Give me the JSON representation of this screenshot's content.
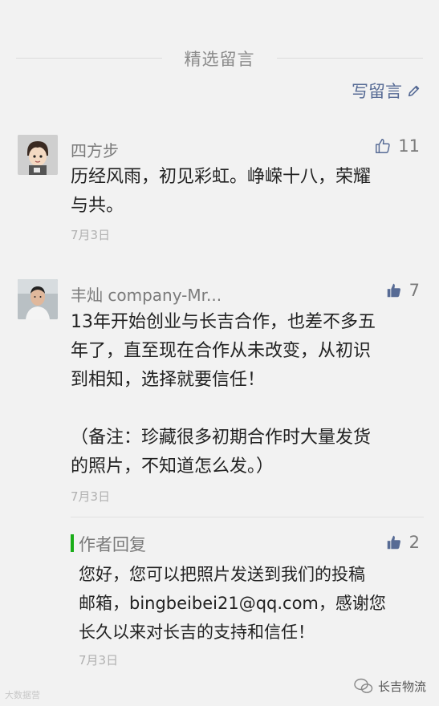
{
  "section": {
    "title": "精选留言"
  },
  "write_button": {
    "label": "写留言",
    "icon": "pencil-icon"
  },
  "comments": [
    {
      "name": "四方步",
      "likes": "11",
      "content": "历经风雨，初见彩虹。峥嵘十八，荣耀\n与共。",
      "date": "7月3日",
      "avatar": "cartoon-avatar",
      "like_filled": false
    },
    {
      "name": "丰灿 company-Mr...",
      "likes": "7",
      "content": "13年开始创业与长吉合作，也差不多五\n年了，直至现在合作从未改变，从初识\n到相知，选择就要信任！\n\n（备注：珍藏很多初期合作时大量发货\n的照片，不知道怎么发。）",
      "date": "7月3日",
      "avatar": "photo-avatar",
      "like_filled": true,
      "reply": {
        "title": "作者回复",
        "likes": "2",
        "content": "您好，您可以把照片发送到我们的投稿\n邮箱，bingbeibei21@qq.com，感谢您\n长久以来对长吉的支持和信任！",
        "date": "7月3日"
      }
    }
  ],
  "watermarks": {
    "left": "大数据营",
    "right": "长吉物流"
  },
  "colors": {
    "link": "#576b95",
    "reply_bar": "#1aad19",
    "background": "#f2f2f2"
  }
}
